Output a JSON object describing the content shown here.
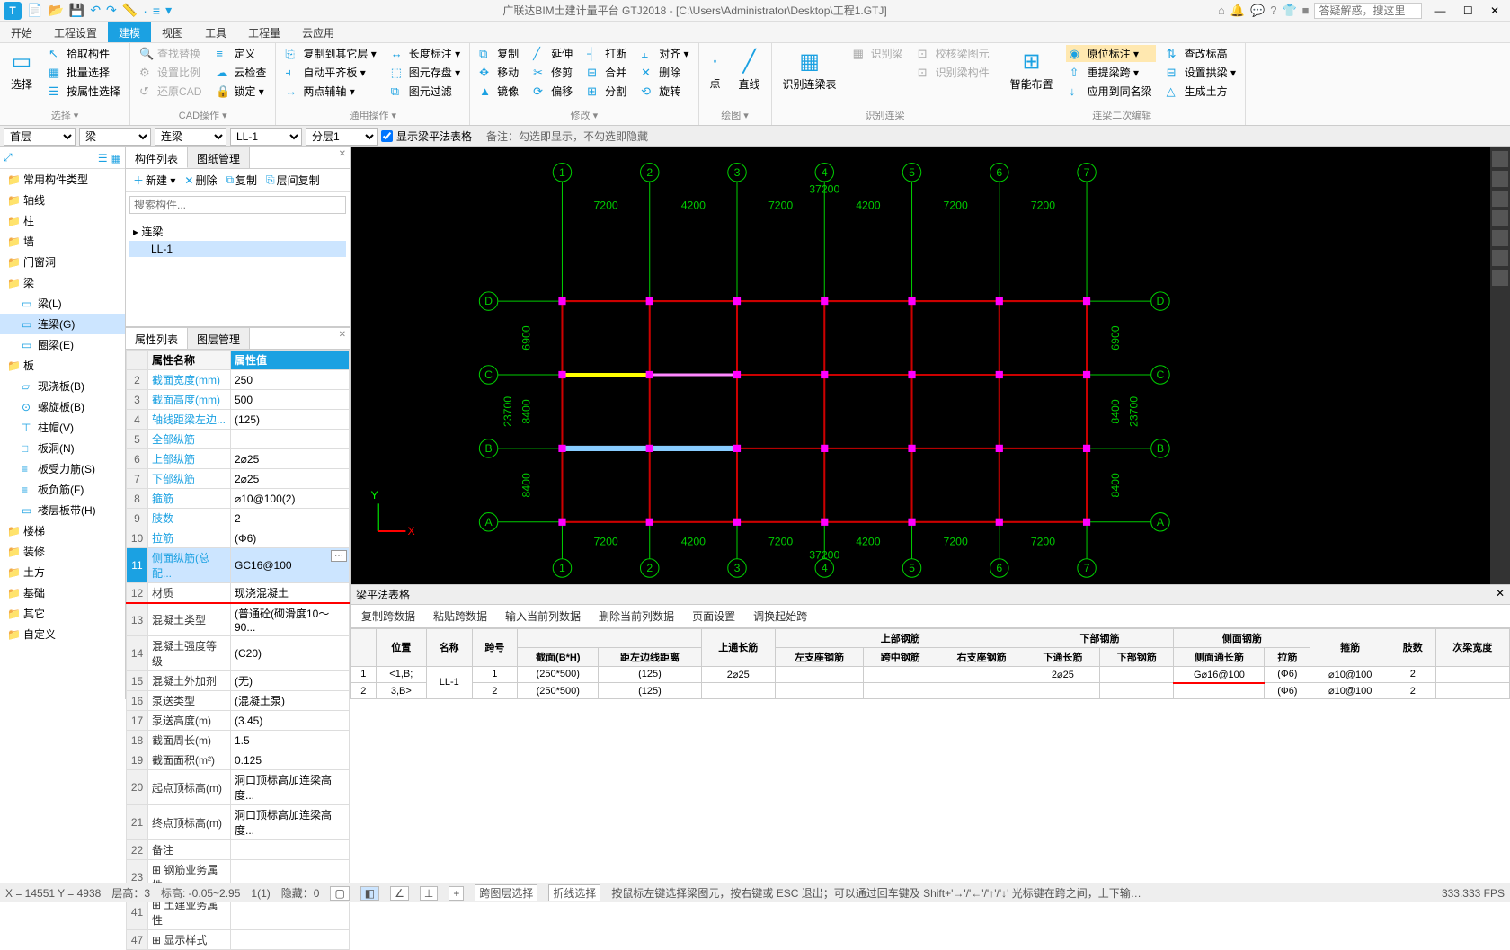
{
  "app": {
    "title": "广联达BIM土建计量平台 GTJ2018 - [C:\\Users\\Administrator\\Desktop\\工程1.GTJ]",
    "search_placeholder": "答疑解惑，搜这里"
  },
  "main_tabs": [
    "开始",
    "工程设置",
    "建模",
    "视图",
    "工具",
    "工程量",
    "云应用"
  ],
  "main_tab_active": 2,
  "ribbon": {
    "groups": [
      {
        "label": "选择 ▾",
        "big": {
          "icon": "▭",
          "text": "选择"
        },
        "cols": [
          [
            {
              "icon": "↖",
              "text": "拾取构件"
            },
            {
              "icon": "▦",
              "text": "批量选择"
            },
            {
              "icon": "☰",
              "text": "按属性选择"
            }
          ]
        ]
      },
      {
        "label": "CAD操作 ▾",
        "cols": [
          [
            {
              "icon": "🔍",
              "text": "查找替换",
              "dim": true
            },
            {
              "icon": "⚙",
              "text": "设置比例",
              "dim": true
            },
            {
              "icon": "↺",
              "text": "还原CAD",
              "dim": true
            }
          ],
          [
            {
              "icon": "≡",
              "text": "定义"
            },
            {
              "icon": "☁",
              "text": "云检查"
            },
            {
              "icon": "🔒",
              "text": "锁定 ▾"
            }
          ]
        ]
      },
      {
        "label": "通用操作 ▾",
        "cols": [
          [
            {
              "icon": "⎘",
              "text": "复制到其它层 ▾"
            },
            {
              "icon": "⫞",
              "text": "自动平齐板 ▾"
            },
            {
              "icon": "↔",
              "text": "两点辅轴 ▾"
            }
          ],
          [
            {
              "icon": "↔",
              "text": "长度标注 ▾"
            },
            {
              "icon": "⬚",
              "text": "图元存盘 ▾"
            },
            {
              "icon": "⧉",
              "text": "图元过滤"
            }
          ]
        ]
      },
      {
        "label": "修改 ▾",
        "cols": [
          [
            {
              "icon": "⧉",
              "text": "复制"
            },
            {
              "icon": "✥",
              "text": "移动"
            },
            {
              "icon": "▲",
              "text": "镜像"
            }
          ],
          [
            {
              "icon": "╱",
              "text": "延伸"
            },
            {
              "icon": "✂",
              "text": "修剪"
            },
            {
              "icon": "⟳",
              "text": "偏移"
            }
          ],
          [
            {
              "icon": "┤",
              "text": "打断"
            },
            {
              "icon": "⊟",
              "text": "合并"
            },
            {
              "icon": "⊞",
              "text": "分割"
            }
          ],
          [
            {
              "icon": "⫠",
              "text": "对齐 ▾"
            },
            {
              "icon": "✕",
              "text": "删除"
            },
            {
              "icon": "⟲",
              "text": "旋转"
            }
          ]
        ]
      },
      {
        "label": "绘图 ▾",
        "big2": [
          {
            "icon": "·",
            "text": "点"
          },
          {
            "icon": "╱",
            "text": "直线"
          }
        ]
      },
      {
        "label": "识别连梁",
        "big": {
          "icon": "▦",
          "text": "识别连梁表"
        },
        "cols": [
          [
            {
              "icon": "▦",
              "text": "识别梁",
              "dim": true
            }
          ],
          [
            {
              "icon": "⊡",
              "text": "校核梁图元",
              "dim": true
            },
            {
              "icon": "⊡",
              "text": "识别梁构件",
              "dim": true
            }
          ]
        ]
      },
      {
        "label": "连梁二次编辑",
        "big": {
          "icon": "⊞",
          "text": "智能布置"
        },
        "cols": [
          [
            {
              "icon": "◉",
              "text": "原位标注 ▾",
              "hl": true
            },
            {
              "icon": "⇧",
              "text": "重提梁跨 ▾"
            },
            {
              "icon": "↓",
              "text": "应用到同名梁"
            }
          ],
          [
            {
              "icon": "⇅",
              "text": "查改标高"
            },
            {
              "icon": "⊟",
              "text": "设置拱梁 ▾"
            },
            {
              "icon": "△",
              "text": "生成土方"
            }
          ]
        ]
      }
    ]
  },
  "selectors": {
    "floor": "首层",
    "cat": "梁",
    "type": "连梁",
    "name": "LL-1",
    "layer": "分层1",
    "chk_label": "显示梁平法表格",
    "note": "备注：勾选即显示，不勾选即隐藏"
  },
  "left_tree": [
    {
      "t": "常用构件类型",
      "lvl": 1,
      "ic": "📁"
    },
    {
      "t": "轴线",
      "lvl": 1,
      "ic": "📁"
    },
    {
      "t": "柱",
      "lvl": 1,
      "ic": "📁"
    },
    {
      "t": "墙",
      "lvl": 1,
      "ic": "📁"
    },
    {
      "t": "门窗洞",
      "lvl": 1,
      "ic": "📁"
    },
    {
      "t": "梁",
      "lvl": 1,
      "ic": "📁",
      "open": true
    },
    {
      "t": "梁(L)",
      "lvl": 2,
      "ic": "▭"
    },
    {
      "t": "连梁(G)",
      "lvl": 2,
      "ic": "▭",
      "sel": true
    },
    {
      "t": "圈梁(E)",
      "lvl": 2,
      "ic": "▭"
    },
    {
      "t": "板",
      "lvl": 1,
      "ic": "📁",
      "open": true
    },
    {
      "t": "现浇板(B)",
      "lvl": 2,
      "ic": "▱"
    },
    {
      "t": "螺旋板(B)",
      "lvl": 2,
      "ic": "⊙"
    },
    {
      "t": "柱帽(V)",
      "lvl": 2,
      "ic": "⊤"
    },
    {
      "t": "板洞(N)",
      "lvl": 2,
      "ic": "□"
    },
    {
      "t": "板受力筋(S)",
      "lvl": 2,
      "ic": "≡"
    },
    {
      "t": "板负筋(F)",
      "lvl": 2,
      "ic": "≡"
    },
    {
      "t": "楼层板带(H)",
      "lvl": 2,
      "ic": "▭"
    },
    {
      "t": "楼梯",
      "lvl": 1,
      "ic": "📁"
    },
    {
      "t": "装修",
      "lvl": 1,
      "ic": "📁"
    },
    {
      "t": "土方",
      "lvl": 1,
      "ic": "📁"
    },
    {
      "t": "基础",
      "lvl": 1,
      "ic": "📁"
    },
    {
      "t": "其它",
      "lvl": 1,
      "ic": "📁"
    },
    {
      "t": "自定义",
      "lvl": 1,
      "ic": "📁"
    }
  ],
  "mid": {
    "tabs": [
      "构件列表",
      "图纸管理"
    ],
    "tb": [
      {
        "ic": "＋",
        "t": "新建 ▾"
      },
      {
        "ic": "✕",
        "t": "删除"
      },
      {
        "ic": "⧉",
        "t": "复制"
      },
      {
        "ic": "⎘",
        "t": "层间复制"
      }
    ],
    "search_ph": "搜索构件...",
    "tree": [
      {
        "t": "▸ 连梁",
        "lvl": 0
      },
      {
        "t": "LL-1",
        "lvl": 1,
        "sel": true
      }
    ]
  },
  "props": {
    "tabs": [
      "属性列表",
      "图层管理"
    ],
    "name_head": "属性名称",
    "val_head": "属性值",
    "rows": [
      {
        "n": 2,
        "name": "截面宽度(mm)",
        "val": "250"
      },
      {
        "n": 3,
        "name": "截面高度(mm)",
        "val": "500"
      },
      {
        "n": 4,
        "name": "轴线距梁左边...",
        "val": "(125)"
      },
      {
        "n": 5,
        "name": "全部纵筋",
        "val": ""
      },
      {
        "n": 6,
        "name": "上部纵筋",
        "val": "2⌀25"
      },
      {
        "n": 7,
        "name": "下部纵筋",
        "val": "2⌀25"
      },
      {
        "n": 8,
        "name": "箍筋",
        "val": "⌀10@100(2)"
      },
      {
        "n": 9,
        "name": "肢数",
        "val": "2"
      },
      {
        "n": 10,
        "name": "拉筋",
        "val": "(Φ6)"
      },
      {
        "n": 11,
        "name": "侧面纵筋(总配...",
        "val": "GC16@100",
        "hl": true,
        "dots": true
      },
      {
        "n": 12,
        "name": "材质",
        "val": "现浇混凝土",
        "black": true,
        "red": true
      },
      {
        "n": 13,
        "name": "混凝土类型",
        "val": "(普通砼(砌滑度10～90...",
        "black": true
      },
      {
        "n": 14,
        "name": "混凝土强度等级",
        "val": "(C20)",
        "black": true
      },
      {
        "n": 15,
        "name": "混凝土外加剂",
        "val": "(无)",
        "black": true
      },
      {
        "n": 16,
        "name": "泵送类型",
        "val": "(混凝土泵)",
        "black": true
      },
      {
        "n": 17,
        "name": "泵送高度(m)",
        "val": "(3.45)",
        "black": true
      },
      {
        "n": 18,
        "name": "截面周长(m)",
        "val": "1.5",
        "black": true
      },
      {
        "n": 19,
        "name": "截面面积(m²)",
        "val": "0.125",
        "black": true
      },
      {
        "n": 20,
        "name": "起点顶标高(m)",
        "val": "洞口顶标高加连梁高度...",
        "black": true
      },
      {
        "n": 21,
        "name": "终点顶标高(m)",
        "val": "洞口顶标高加连梁高度...",
        "black": true
      },
      {
        "n": 22,
        "name": "备注",
        "val": "",
        "black": true
      },
      {
        "n": 23,
        "name": "⊞ 钢筋业务属性",
        "val": "",
        "black": true
      },
      {
        "n": 41,
        "name": "⊞ 土建业务属性",
        "val": "",
        "black": true
      },
      {
        "n": 47,
        "name": "⊞ 显示样式",
        "val": "",
        "black": true
      }
    ]
  },
  "bottom": {
    "title": "梁平法表格",
    "tb": [
      "复制跨数据",
      "粘贴跨数据",
      "输入当前列数据",
      "删除当前列数据",
      "页面设置",
      "调换起始跨"
    ],
    "headers": {
      "pos": "位置",
      "name": "名称",
      "span": "跨号",
      "section_grp": "",
      "section": "截面(B*H)",
      "dist": "距左边线距离",
      "top_long": "上通长筋",
      "top_grp": "上部钢筋",
      "left_sup": "左支座钢筋",
      "mid_span": "跨中钢筋",
      "right_sup": "右支座钢筋",
      "bot_grp": "下部钢筋",
      "bot_long": "下通长筋",
      "bot_rebar": "下部钢筋",
      "side_grp": "侧面钢筋",
      "side_long": "侧面通长筋",
      "tie": "拉筋",
      "stirrup": "箍筋",
      "legs": "肢数",
      "next_w": "次梁宽度"
    },
    "rows": [
      {
        "idx": 1,
        "pos": "<1,B;",
        "name": "LL-1",
        "span": "1",
        "sec": "(250*500)",
        "dist": "(125)",
        "top_long": "2⌀25",
        "bot_long": "2⌀25",
        "side_long": "G⌀16@100",
        "tie": "(Φ6)",
        "stirrup": "⌀10@100",
        "legs": "2"
      },
      {
        "idx": 2,
        "pos": "3,B>",
        "name": "",
        "span": "2",
        "sec": "(250*500)",
        "dist": "(125)",
        "top_long": "",
        "bot_long": "",
        "side_long": "",
        "tie": "(Φ6)",
        "stirrup": "⌀10@100",
        "legs": "2"
      }
    ]
  },
  "status": {
    "coord": "X = 14551 Y = 4938",
    "floor": "层高：3",
    "elev": "标高: -0.05~2.95",
    "scale": "1(1)",
    "hidden": "隐藏：0",
    "b1": "跨图层选择",
    "b2": "折线选择",
    "hint": "按鼠标左键选择梁图元，按右键或 ESC 退出；可以通过回车键及 Shift+'→'/'←'/'↑'/'↓' 光标键在跨之间，上下输入框之间进行切换",
    "fps": "333.333 FPS"
  },
  "canvas": {
    "axis_x": [
      "1",
      "2",
      "3",
      "4",
      "5",
      "6",
      "7"
    ],
    "axis_y": [
      "A",
      "B",
      "C",
      "D"
    ],
    "dims_top": [
      "7200",
      "4200",
      "7200",
      "4200",
      "7200",
      "7200"
    ],
    "total": "37200",
    "dims_left": [
      "8400",
      "8400",
      "6900"
    ],
    "total_left": "23700"
  }
}
